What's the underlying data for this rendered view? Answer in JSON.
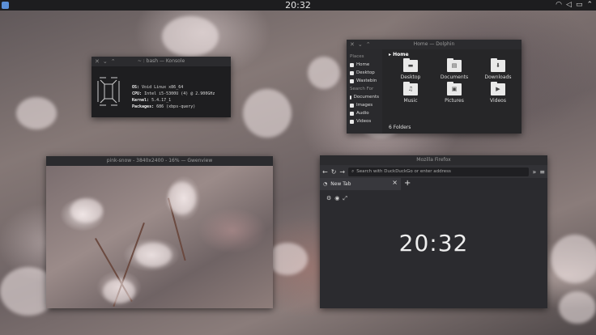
{
  "panel": {
    "clock": "20:32",
    "tray_icons": [
      "wifi-icon",
      "volume-icon",
      "battery-icon",
      "chevron-up-icon"
    ]
  },
  "konsole": {
    "title": "~ : bash — Konsole",
    "info": [
      {
        "key": "OS:",
        "value": "Void Linux x86_64"
      },
      {
        "key": "CPU:",
        "value": "Intel i5-5300U (4) @ 2.900GHz"
      },
      {
        "key": "Kernel:",
        "value": "5.4.17_1"
      },
      {
        "key": "Packages:",
        "value": "686 (xbps-query)"
      }
    ]
  },
  "dolphin": {
    "title": "Home — Dolphin",
    "places_header": "Places",
    "places": [
      "Home",
      "Desktop",
      "Wastebin"
    ],
    "search_header": "Search For",
    "search_items": [
      "Documents",
      "Images",
      "Audio",
      "Videos"
    ],
    "breadcrumb": "Home",
    "folders": [
      {
        "name": "Desktop",
        "icon": "folder-desktop-icon"
      },
      {
        "name": "Documents",
        "icon": "folder-documents-icon"
      },
      {
        "name": "Downloads",
        "icon": "folder-downloads-icon"
      },
      {
        "name": "Music",
        "icon": "folder-music-icon"
      },
      {
        "name": "Pictures",
        "icon": "folder-pictures-icon"
      },
      {
        "name": "Videos",
        "icon": "folder-videos-icon"
      }
    ],
    "status": "6 Folders"
  },
  "gwenview": {
    "title": "pink-snow - 3840x2400 - 16% — Gwenview"
  },
  "firefox": {
    "title": "Mozilla Firefox",
    "url_placeholder": "Search with DuckDuckGo or enter address",
    "tab_label": "New Tab",
    "clock": "20:32"
  }
}
